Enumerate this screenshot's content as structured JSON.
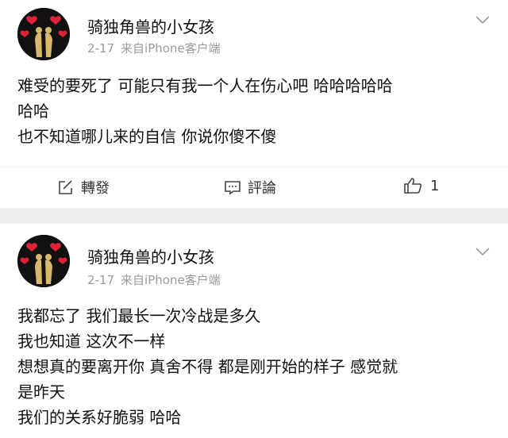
{
  "posts": [
    {
      "username": "骑独角兽的小女孩",
      "date": "2-17",
      "source": "来自iPhone客户端",
      "lines": [
        "难受的要死了 可能只有我一个人在伤心吧 哈哈哈哈哈",
        "哈哈",
        "也不知道哪儿来的自信 你说你傻不傻"
      ],
      "actions": {
        "repost_label": "轉發",
        "comment_label": "評論",
        "like_count": "1"
      }
    },
    {
      "username": "骑独角兽的小女孩",
      "date": "2-17",
      "source": "来自iPhone客户端",
      "lines": [
        "我都忘了 我们最长一次冷战是多久",
        "我也知道 这次不一样",
        "想想真的要离开你 真舍不得 都是刚开始的样子 感觉就",
        "是昨天",
        "我们的关系好脆弱  哈哈"
      ]
    }
  ],
  "colors": {
    "background": "#efefef",
    "card": "#ffffff",
    "meta_text": "#9a9a9a",
    "heart": "#e0213a",
    "avatar_figure": "#d9b86a"
  },
  "icons": {
    "avatar": "couple-hearts-avatar",
    "dropdown": "chevron-down-icon",
    "repost": "edit-share-icon",
    "comment": "comment-icon",
    "like": "thumbs-up-icon"
  }
}
